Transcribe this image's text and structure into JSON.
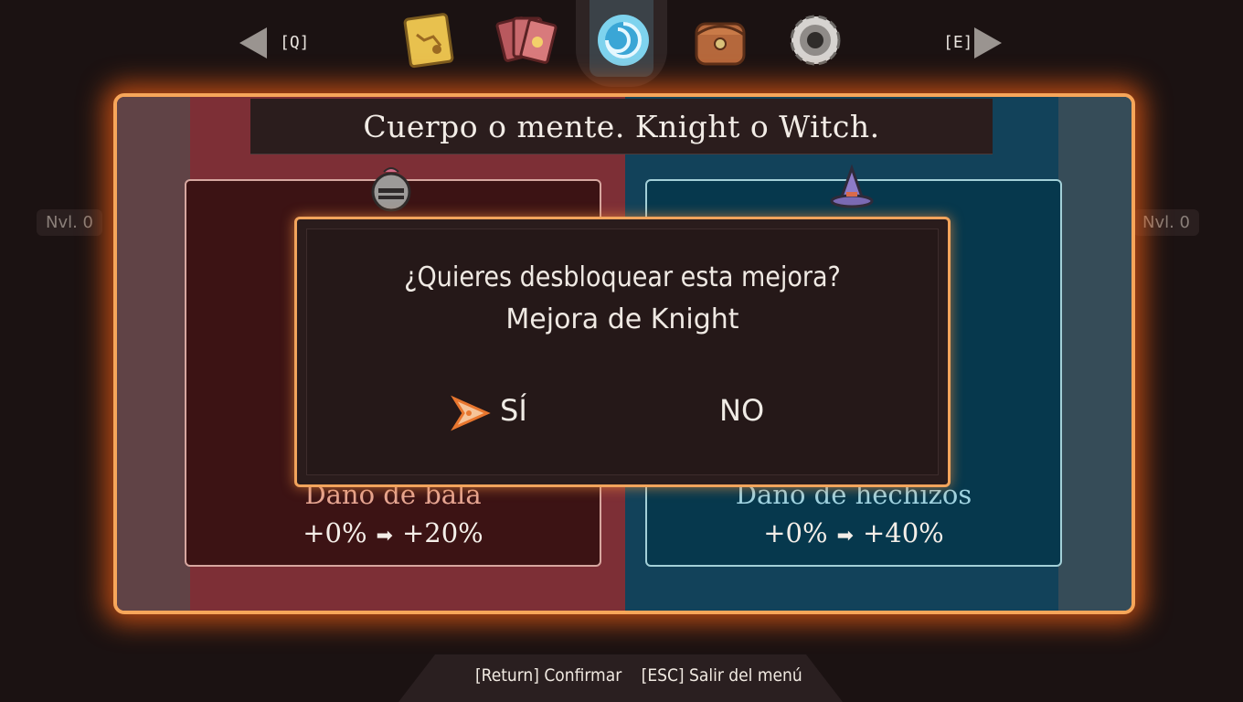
{
  "nav": {
    "prev_key": "[Q]",
    "next_key": "[E]",
    "tabs": [
      {
        "name": "map-tab",
        "icon": "treasure-map-icon"
      },
      {
        "name": "cards-tab",
        "icon": "cards-icon"
      },
      {
        "name": "portal-tab",
        "icon": "portal-vortex-icon",
        "active": true
      },
      {
        "name": "bag-tab",
        "icon": "satchel-icon"
      },
      {
        "name": "settings-tab",
        "icon": "gear-icon"
      }
    ]
  },
  "side_levels": {
    "left": "Nvl. 0",
    "right": "Nvl. 0"
  },
  "panel": {
    "title": "Cuerpo o mente. Knight o Witch."
  },
  "knight": {
    "emblem_icon": "knight-helmet-icon",
    "stat_name": "Daño de bala",
    "from": "+0%",
    "to": "+20%"
  },
  "witch": {
    "emblem_icon": "witch-hat-icon",
    "stat_name": "Daño de hechizos",
    "from": "+0%",
    "to": "+40%"
  },
  "dialog": {
    "question": "¿Quieres desbloquear esta mejora?",
    "subject": "Mejora de Knight",
    "yes_label": "SÍ",
    "no_label": "NO"
  },
  "footer": {
    "confirm": "[Return] Confirmar",
    "exit": "[ESC] Salir del menú"
  },
  "colors": {
    "frame_glow": "#f7a65a",
    "knight_bg": "#7d2f36",
    "witch_bg": "#12425a"
  }
}
